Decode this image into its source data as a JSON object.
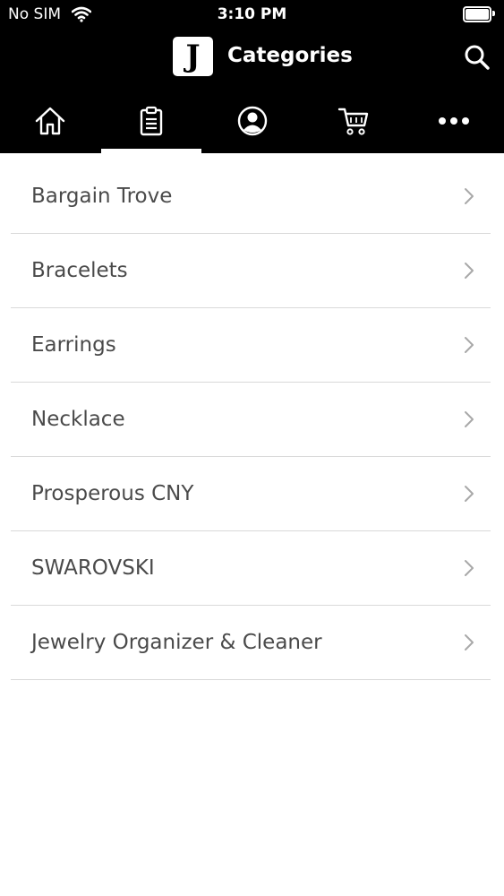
{
  "status_bar": {
    "carrier": "No SIM",
    "time": "3:10 PM",
    "wifi_icon": "wifi-icon",
    "battery_icon": "battery-full-icon"
  },
  "header": {
    "logo_letter": "J",
    "title": "Categories",
    "search_icon": "search-icon",
    "background_color": "#000000",
    "text_color": "#ffffff"
  },
  "tabs": [
    {
      "icon": "home-icon",
      "selected": false
    },
    {
      "icon": "clipboard-icon",
      "selected": true
    },
    {
      "icon": "account-icon",
      "selected": false
    },
    {
      "icon": "cart-icon",
      "selected": false
    },
    {
      "icon": "more-icon",
      "selected": false
    }
  ],
  "categories": [
    {
      "label": "Bargain Trove"
    },
    {
      "label": "Bracelets"
    },
    {
      "label": "Earrings"
    },
    {
      "label": "Necklace"
    },
    {
      "label": "Prosperous CNY"
    },
    {
      "label": "SWAROVSKI"
    },
    {
      "label": "Jewelry Organizer & Cleaner"
    }
  ],
  "chevron_icon": "chevron-right-icon"
}
